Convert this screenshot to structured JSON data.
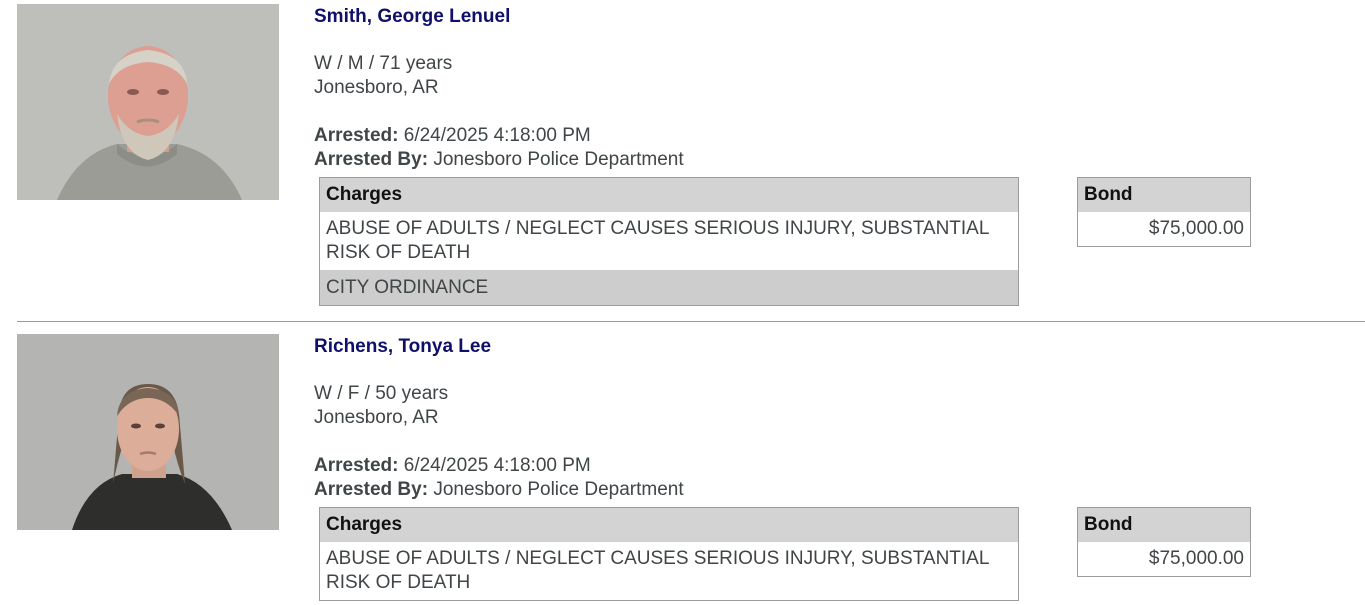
{
  "records": [
    {
      "name": "Smith, George Lenuel",
      "demographics": "W / M / 71 years",
      "city": "Jonesboro, AR",
      "arrested_label": "Arrested:",
      "arrested": "6/24/2025 4:18:00 PM",
      "arrested_by_label": "Arrested By:",
      "arrested_by": "Jonesboro Police Department",
      "charges_header": "Charges",
      "charges": [
        "ABUSE OF ADULTS / NEGLECT CAUSES SERIOUS INJURY, SUBSTANTIAL RISK OF DEATH",
        "CITY ORDINANCE"
      ],
      "bond_header": "Bond",
      "bond": "$75,000.00"
    },
    {
      "name": "Richens, Tonya Lee",
      "demographics": "W / F / 50 years",
      "city": "Jonesboro, AR",
      "arrested_label": "Arrested:",
      "arrested": "6/24/2025 4:18:00 PM",
      "arrested_by_label": "Arrested By:",
      "arrested_by": "Jonesboro Police Department",
      "charges_header": "Charges",
      "charges": [
        "ABUSE OF ADULTS / NEGLECT CAUSES SERIOUS INJURY, SUBSTANTIAL RISK OF DEATH"
      ],
      "bond_header": "Bond",
      "bond": "$75,000.00"
    }
  ],
  "colors": {
    "name": "#10106a",
    "text": "#404548",
    "table_header_bg": "#d3d3d3",
    "alt_row_bg": "#cdcdcd",
    "border": "#9c9c9c"
  }
}
